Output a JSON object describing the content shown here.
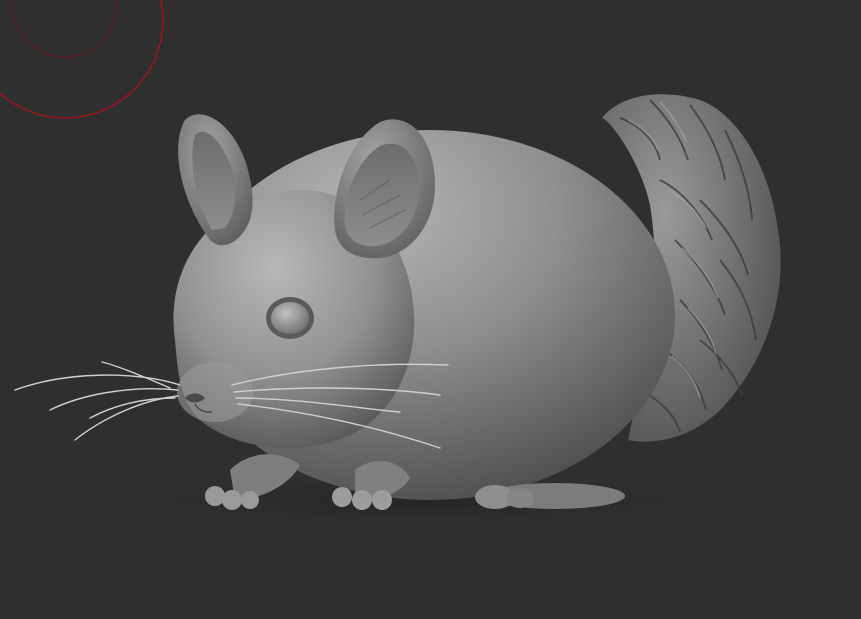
{
  "viewport": {
    "background_color": "#2f2f2f",
    "model_base_color": "#8a8a8a",
    "model_highlight_color": "#b9b9b9",
    "model_shadow_color": "#3d3d3d",
    "brush_cursor_color": "#a0141a"
  },
  "model": {
    "subject": "chinchilla",
    "parts": [
      "body",
      "head",
      "left-ear",
      "right-ear",
      "eye",
      "nose",
      "whiskers",
      "front-paws",
      "hind-foot",
      "tail"
    ]
  },
  "brush_cursor": {
    "visible": true,
    "rings": 2
  }
}
